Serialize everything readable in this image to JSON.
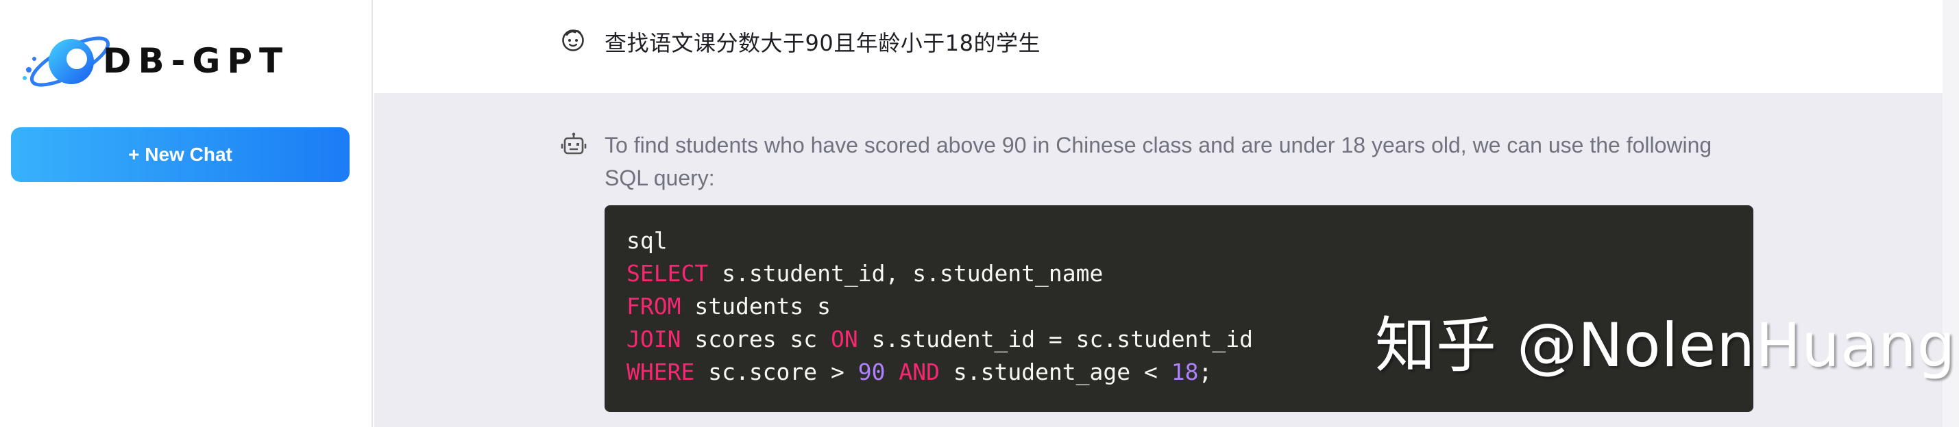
{
  "sidebar": {
    "logo_text": "DB-GPT",
    "new_chat_label": "+ New Chat"
  },
  "conversation": {
    "user_message": "查找语文课分数大于90且年龄小于18的学生",
    "assistant_text": "To find students who have scored above 90 in Chinese class and are under 18 years old, we can use the following SQL query:",
    "code_language": "sql",
    "code": {
      "line1": {
        "kw1": "SELECT",
        "rest": " s.student_id, s.student_name"
      },
      "line2": {
        "kw1": "FROM",
        "rest": " students s"
      },
      "line3": {
        "kw1": "JOIN",
        "mid": " scores sc ",
        "kw2": "ON",
        "rest": " s.student_id = sc.student_id"
      },
      "line4": {
        "kw1": "WHERE",
        "mid": " sc.score > ",
        "num1": "90",
        "sp": " ",
        "kw2": "AND",
        "mid2": " s.student_age < ",
        "num2": "18",
        "end": ";"
      }
    }
  },
  "watermark": "知乎 @NolenHuang",
  "icons": {
    "user": "user-avatar-icon",
    "assistant": "robot-icon",
    "logo": "db-gpt-logo-icon"
  },
  "colors": {
    "accent_start": "#38b2fb",
    "accent_end": "#1b7cf5",
    "code_bg": "#2a2b27",
    "keyword": "#f92672",
    "number": "#ae81ff"
  }
}
